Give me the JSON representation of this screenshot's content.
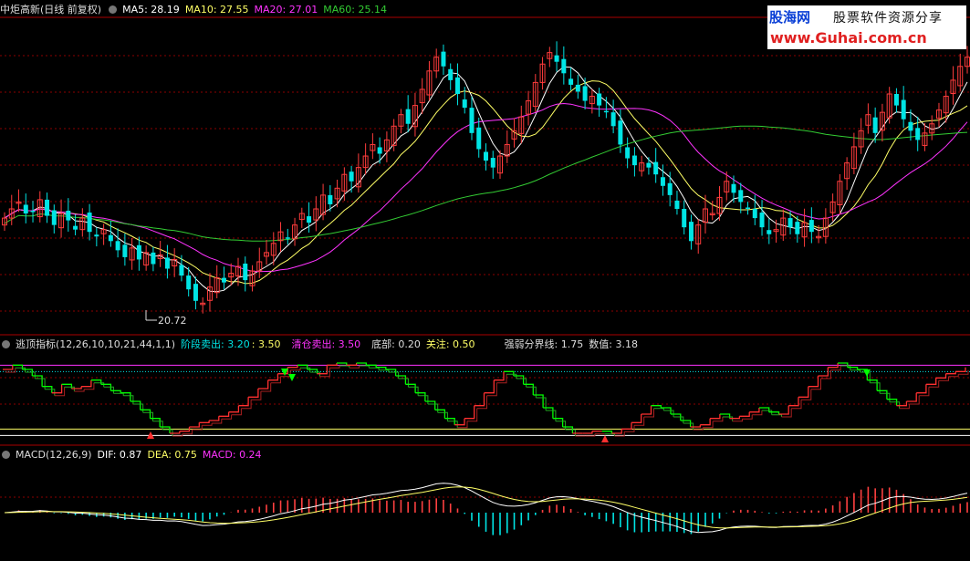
{
  "header": {
    "title": "中炬高新(日线 前复权)",
    "ma5": "MA5: 28.19",
    "ma10": "MA10: 27.55",
    "ma20": "MA20: 27.01",
    "ma60": "MA60: 25.14"
  },
  "indicator": {
    "title": "逃顶指标(12,26,10,10,21,44,1,1)",
    "stage_sell": "阶段卖出: 3.20",
    "stage_sell2": ": 3.50",
    "clear_sell": "清仓卖出: 3.50",
    "bottom": "底部: 0.20",
    "watch": "关注: 0.50",
    "divide": "强弱分界线: 1.75",
    "value": "数值: 3.18"
  },
  "macd": {
    "title": "MACD(12,26,9)",
    "dif": "DIF: 0.87",
    "dea": "DEA: 0.75",
    "macd": "MACD: 0.24"
  },
  "watermark": {
    "brand": "股海网",
    "slogan": "股票软件资源分享",
    "url": "www.Guhai.com.cn"
  },
  "colors": {
    "up": "#ff3c3c",
    "down": "#00e5e5",
    "ma5": "#ffffff",
    "ma10": "#ffff66",
    "ma20": "#ff33ff",
    "ma60": "#33cc33",
    "grid": "#8b0000",
    "indicator_up": "#ff3030",
    "indicator_down": "#00ff00",
    "dif": "#ffffff",
    "dea": "#ffff66"
  },
  "chart_data": [
    {
      "type": "candlestick",
      "title": "中炬高新(日线 前复权)",
      "annotations": [
        {
          "text": "20.72",
          "label": "low"
        }
      ],
      "series": [
        {
          "name": "MA5",
          "last": 28.19
        },
        {
          "name": "MA10",
          "last": 27.55
        },
        {
          "name": "MA20",
          "last": 27.01
        },
        {
          "name": "MA60",
          "last": 25.14
        }
      ],
      "close": [
        24.6,
        25.0,
        25.3,
        24.8,
        24.9,
        25.4,
        24.7,
        24.3,
        24.8,
        24.5,
        24.1,
        24.6,
        24.0,
        23.8,
        24.1,
        23.6,
        23.2,
        22.9,
        23.3,
        22.8,
        23.1,
        22.6,
        23.0,
        22.4,
        22.8,
        22.1,
        21.5,
        21.0,
        20.9,
        21.6,
        22.0,
        21.8,
        22.2,
        22.5,
        21.9,
        22.3,
        22.7,
        23.1,
        23.5,
        24.0,
        23.7,
        24.3,
        24.8,
        24.4,
        25.0,
        25.6,
        25.2,
        25.9,
        26.5,
        26.2,
        26.8,
        27.3,
        27.8,
        27.4,
        28.0,
        28.6,
        29.1,
        28.7,
        29.5,
        30.2,
        31.0,
        31.6,
        31.2,
        30.6,
        30.0,
        29.4,
        28.3,
        27.6,
        27.1,
        26.8,
        27.3,
        27.8,
        28.4,
        29.0,
        29.7,
        30.5,
        31.3,
        31.8,
        31.4,
        30.9,
        30.4,
        30.1,
        29.7,
        29.9,
        29.5,
        29.2,
        28.6,
        27.8,
        27.2,
        26.9,
        27.0,
        26.8,
        26.5,
        26.0,
        25.6,
        25.0,
        24.2,
        23.6,
        24.3,
        25.0,
        24.8,
        25.5,
        26.2,
        25.7,
        25.3,
        25.0,
        24.6,
        24.2,
        23.9,
        24.1,
        24.6,
        24.2,
        23.9,
        24.4,
        24.0,
        23.8,
        24.6,
        25.3,
        26.2,
        27.0,
        27.7,
        28.4,
        29.1,
        28.3,
        29.2,
        30.0,
        29.5,
        28.9,
        28.4,
        28.0,
        28.3,
        28.7,
        29.3,
        29.9,
        30.6,
        31.2,
        31.6
      ],
      "low_label": 20.72
    },
    {
      "type": "line",
      "title": "逃顶指标(12,26,10,10,21,44,1,1)",
      "levels": [
        {
          "name": "阶段卖出",
          "value": 3.2
        },
        {
          "name": "清仓卖出",
          "value": 3.5
        },
        {
          "name": "底部",
          "value": 0.2
        },
        {
          "name": "关注",
          "value": 0.5
        },
        {
          "name": "强弱分界线",
          "value": 1.75
        }
      ],
      "series": [
        {
          "name": "数值",
          "last": 3.18,
          "values": [
            3.3,
            3.5,
            3.3,
            3.0,
            2.5,
            2.2,
            2.6,
            2.4,
            2.5,
            2.8,
            2.6,
            2.3,
            2.2,
            1.8,
            1.4,
            1.0,
            0.6,
            0.3,
            0.4,
            0.6,
            0.8,
            0.9,
            1.1,
            1.3,
            1.6,
            2.0,
            2.4,
            2.8,
            3.1,
            3.4,
            3.5,
            3.3,
            3.1,
            3.5,
            3.6,
            3.5,
            3.6,
            3.5,
            3.4,
            3.3,
            3.0,
            2.6,
            2.2,
            1.8,
            1.4,
            1.0,
            0.7,
            1.0,
            1.6,
            2.2,
            2.8,
            3.2,
            3.0,
            2.6,
            2.1,
            1.5,
            1.0,
            0.6,
            0.3,
            0.3,
            0.4,
            0.4,
            0.3,
            0.5,
            0.8,
            1.2,
            1.6,
            1.5,
            1.2,
            0.9,
            0.6,
            0.7,
            1.0,
            1.2,
            1.0,
            1.1,
            1.3,
            1.5,
            1.3,
            1.2,
            1.6,
            2.0,
            2.5,
            3.0,
            3.4,
            3.6,
            3.4,
            3.3,
            2.8,
            2.3,
            1.9,
            1.6,
            1.8,
            2.2,
            2.6,
            2.9,
            3.1,
            3.2,
            3.4
          ]
        }
      ]
    },
    {
      "type": "bar",
      "title": "MACD(12,26,9)",
      "series": [
        {
          "name": "DIF",
          "last": 0.87
        },
        {
          "name": "DEA",
          "last": 0.75
        },
        {
          "name": "MACD",
          "last": 0.24
        }
      ]
    }
  ]
}
